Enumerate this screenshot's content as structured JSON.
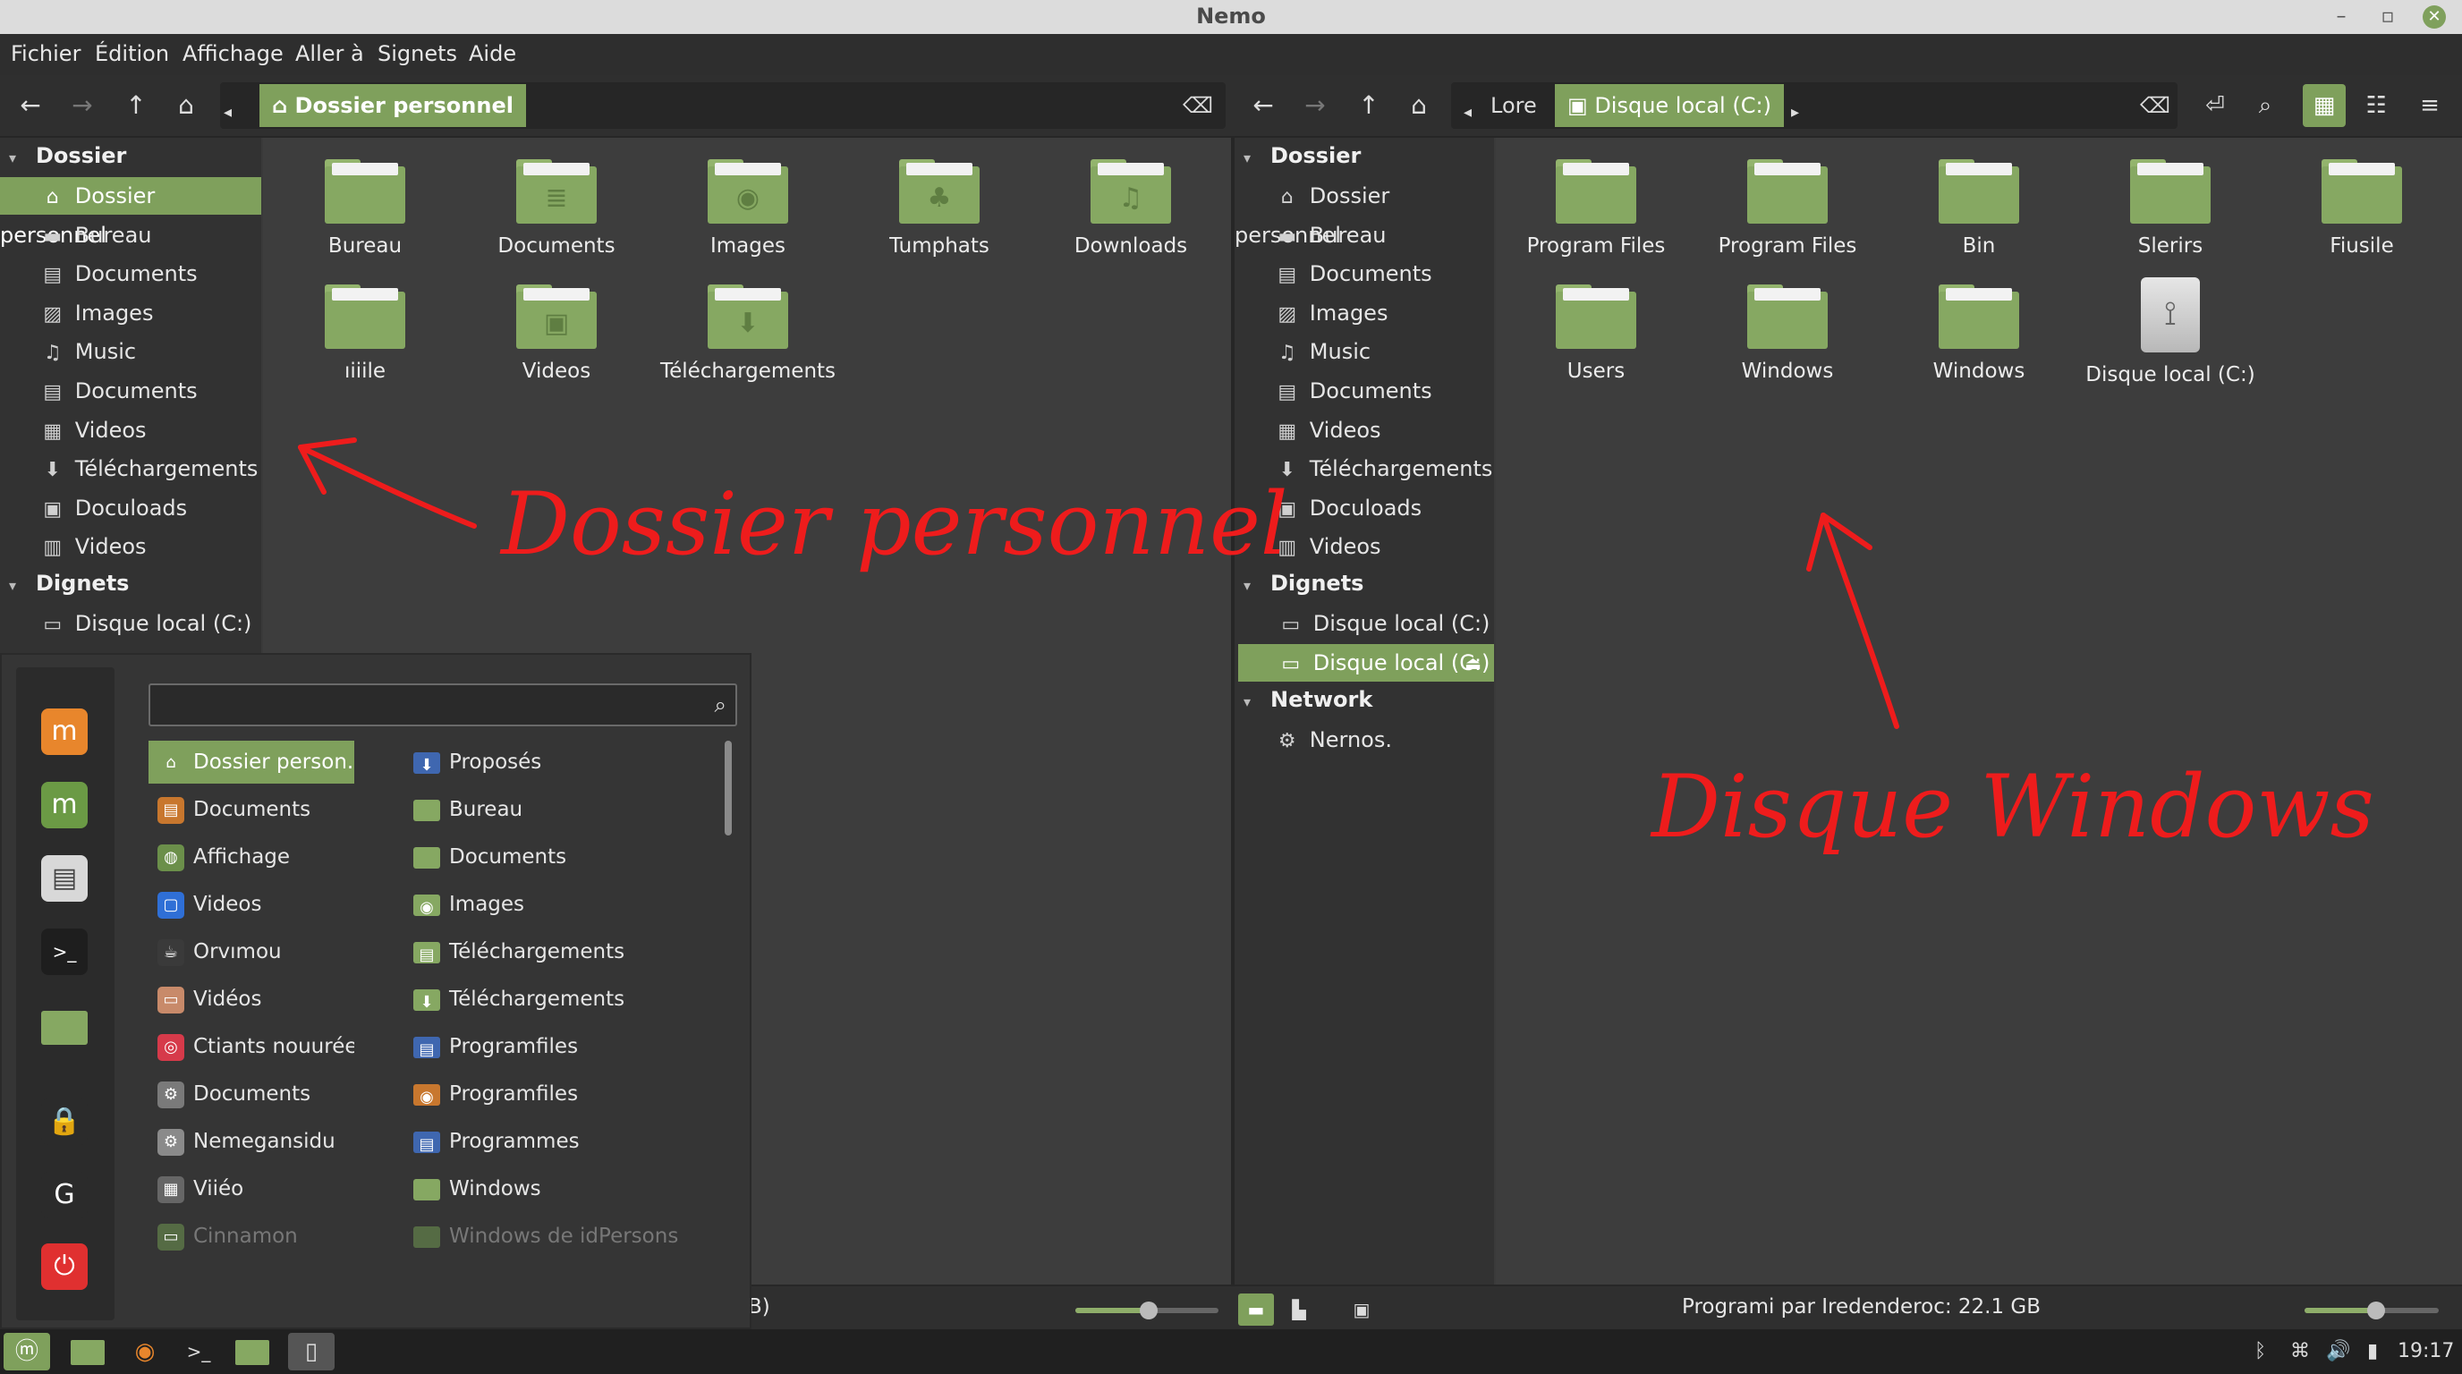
{
  "window": {
    "title": "Nemo"
  },
  "menubar": [
    "Fichier",
    "Édition",
    "Affichage",
    "Aller à",
    "Signets",
    "Aide"
  ],
  "left": {
    "breadcrumb": {
      "label": "Dossier personnel"
    },
    "sidebar": {
      "section_dossier": "Dossier",
      "items": [
        {
          "label": "Dossier personnel",
          "icon": "home-icon",
          "selected": true
        },
        {
          "label": "Bureau",
          "icon": "desktop-icon"
        },
        {
          "label": "Documents",
          "icon": "document-icon"
        },
        {
          "label": "Images",
          "icon": "image-icon"
        },
        {
          "label": "Music",
          "icon": "music-icon"
        },
        {
          "label": "Documents",
          "icon": "document-icon"
        },
        {
          "label": "Videos",
          "icon": "video-icon"
        },
        {
          "label": "Téléchargements",
          "icon": "download-icon"
        },
        {
          "label": "Doculoads",
          "icon": "archive-icon"
        },
        {
          "label": "Videos",
          "icon": "trash-icon"
        }
      ],
      "section_signets": "Dignets",
      "bookmarks": [
        {
          "label": "Disque local (C:)",
          "icon": "drive-icon"
        }
      ]
    },
    "files": [
      {
        "label": "Bureau",
        "emblem": ""
      },
      {
        "label": "Documents",
        "emblem": "≣"
      },
      {
        "label": "Images",
        "emblem": "◉"
      },
      {
        "label": "Tumphats",
        "emblem": "♣"
      },
      {
        "label": "Downloads",
        "emblem": "♫"
      },
      {
        "label": "ıiiile",
        "emblem": ""
      },
      {
        "label": "Videos",
        "emblem": "▣"
      },
      {
        "label": "Téléchargements",
        "emblem": "⬇"
      }
    ],
    "status_fragment": "B)"
  },
  "right": {
    "breadcrumbs": {
      "prev": "Lore",
      "current": "Disque local (C:)"
    },
    "sidebar": {
      "section_dossier": "Dossier",
      "items": [
        {
          "label": "Dossier personnel",
          "icon": "home-icon"
        },
        {
          "label": "Bureau",
          "icon": "desktop-icon"
        },
        {
          "label": "Documents",
          "icon": "document-icon"
        },
        {
          "label": "Images",
          "icon": "image-icon"
        },
        {
          "label": "Music",
          "icon": "music-icon"
        },
        {
          "label": "Documents",
          "icon": "document-icon"
        },
        {
          "label": "Videos",
          "icon": "video-icon"
        },
        {
          "label": "Téléchargements",
          "icon": "download-icon"
        },
        {
          "label": "Doculoads",
          "icon": "archive-icon"
        },
        {
          "label": "Videos",
          "icon": "trash-icon"
        }
      ],
      "section_signets": "Dignets",
      "bookmarks": [
        {
          "label": "Disque local (C:)",
          "icon": "drive-icon"
        },
        {
          "label": "Disque local (C:)",
          "icon": "drive-icon",
          "selected": true
        }
      ],
      "section_network": "Network",
      "network": [
        {
          "label": "Nernos.",
          "icon": "network-icon"
        }
      ]
    },
    "files": [
      {
        "label": "Program Files",
        "type": "folder"
      },
      {
        "label": "Program Files",
        "type": "folder"
      },
      {
        "label": "Bin",
        "type": "folder"
      },
      {
        "label": "Slerirs",
        "type": "folder"
      },
      {
        "label": "Fiusile",
        "type": "folder"
      },
      {
        "label": "Users",
        "type": "folder"
      },
      {
        "label": "Windows",
        "type": "folder"
      },
      {
        "label": "Windows",
        "type": "folder"
      },
      {
        "label": "Disque local (C:)",
        "type": "drive"
      }
    ],
    "status": "Programi par Iredenderoc: 22.1 GB"
  },
  "annotations": {
    "left": "Dossier personnel",
    "right": "Disque Windows",
    "color": "#ee1c1c"
  },
  "startmenu": {
    "search_placeholder": "",
    "categories": [
      {
        "label": "Dossier person..",
        "color": "#7fa05c",
        "glyph": "⌂",
        "selected": true
      },
      {
        "label": "Documents",
        "color": "#c8772e",
        "glyph": "▤"
      },
      {
        "label": "Affichage",
        "color": "#6b8f4a",
        "glyph": "◍"
      },
      {
        "label": "Videos",
        "color": "#2f6fd6",
        "glyph": "▢"
      },
      {
        "label": "Orvımou",
        "color": "#3a3a3a",
        "glyph": "☕"
      },
      {
        "label": "Vidéos",
        "color": "#c88a6a",
        "glyph": "▭"
      },
      {
        "label": "Ctiants nouurée",
        "color": "#d63a4a",
        "glyph": "◎"
      },
      {
        "label": "Documents",
        "color": "#7a7a7a",
        "glyph": "⚙"
      },
      {
        "label": "Nemegansidu",
        "color": "#8a8a8a",
        "glyph": "⚙"
      },
      {
        "label": "Viiéo",
        "color": "#666666",
        "glyph": "▦"
      },
      {
        "label": "Cinnamon",
        "color": "#556b44",
        "glyph": "▭",
        "dim": true
      }
    ],
    "apps": [
      {
        "label": "Proposés",
        "color": "#3f67b0",
        "glyph": "⬇"
      },
      {
        "label": "Bureau",
        "color": "#86a862",
        "glyph": ""
      },
      {
        "label": "Documents",
        "color": "#86a862",
        "glyph": ""
      },
      {
        "label": "Images",
        "color": "#86a862",
        "glyph": "◉"
      },
      {
        "label": "Téléchargements",
        "color": "#86a862",
        "glyph": "▤"
      },
      {
        "label": "Téléchargements",
        "color": "#86a862",
        "glyph": "⬇"
      },
      {
        "label": "Programfiles",
        "color": "#3f67b0",
        "glyph": "▤"
      },
      {
        "label": "Programfiles",
        "color": "#c8772e",
        "glyph": "◉"
      },
      {
        "label": "Programmes",
        "color": "#3f67b0",
        "glyph": "▤"
      },
      {
        "label": "Windows",
        "color": "#86a862",
        "glyph": ""
      },
      {
        "label": "Windows de idPersons",
        "color": "#556b44",
        "glyph": "",
        "dim": true
      }
    ],
    "favorites": [
      {
        "name": "mint-icon",
        "color": "#e8862c",
        "glyph": "m"
      },
      {
        "name": "mintupdate-icon",
        "color": "#6b9a45",
        "glyph": "m"
      },
      {
        "name": "settings-icon",
        "color": "#d8d8d8",
        "glyph": "▤"
      },
      {
        "name": "terminal-icon",
        "color": "#1e1e1e",
        "glyph": ">_"
      },
      {
        "name": "folder-icon",
        "color": "#86a862",
        "glyph": ""
      },
      {
        "name": "lock-icon",
        "color": "#2b2b2b",
        "glyph": "🔒"
      },
      {
        "name": "logout-icon",
        "color": "#2b2b2b",
        "glyph": "G"
      },
      {
        "name": "power-icon",
        "color": "#e03030",
        "glyph": "⏻"
      }
    ]
  },
  "taskbar": {
    "clock": "19:17",
    "accent": "#7fa05c"
  }
}
